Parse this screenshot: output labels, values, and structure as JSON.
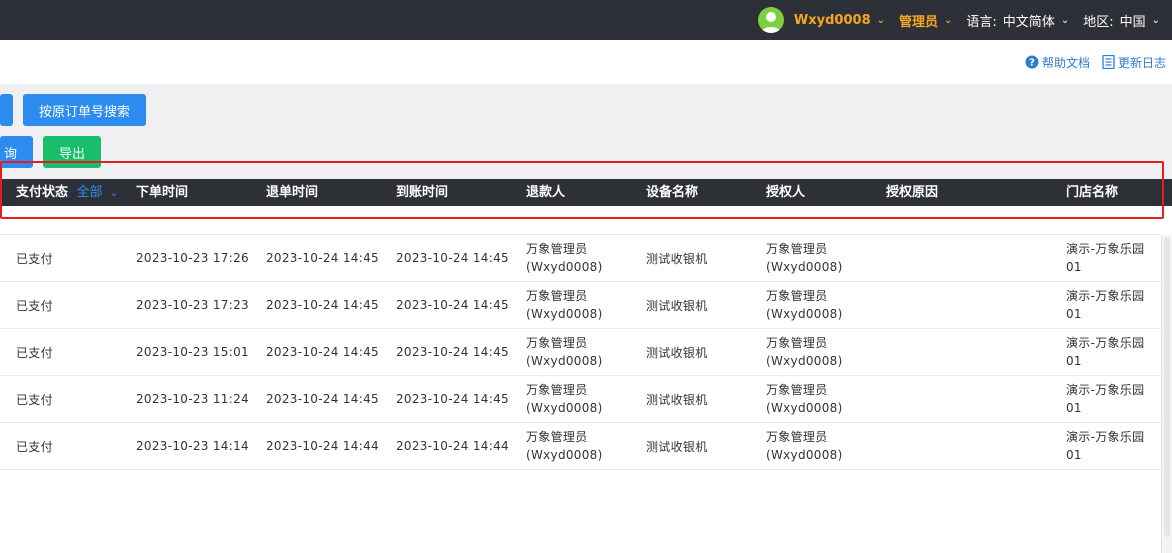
{
  "topbar": {
    "username": "Wxyd0008",
    "role": "管理员",
    "language_label": "语言:",
    "language_value": "中文简体",
    "region_label": "地区:",
    "region_value": "中国"
  },
  "help": {
    "docs": "帮助文档",
    "changelog": "更新日志"
  },
  "toolbar": {
    "search_by_original": "按原订单号搜索",
    "query_partial": "询",
    "export": "导出"
  },
  "table": {
    "headers": {
      "pay_status": "支付状态",
      "pay_status_filter": "全部",
      "order_time": "下单时间",
      "refund_time": "退单时间",
      "arrival_time": "到账时间",
      "refunder": "退款人",
      "device": "设备名称",
      "authorizer": "授权人",
      "auth_reason": "授权原因",
      "store": "门店名称"
    },
    "rows": [
      {
        "status": "已支付",
        "order_time": "2023-10-23 17:26",
        "refund_time": "2023-10-24 14:45",
        "arrival_time": "2023-10-24 14:45",
        "refunder_name": "万象管理员",
        "refunder_id": "(Wxyd0008)",
        "device": "测试收银机",
        "auth_name": "万象管理员",
        "auth_id": "(Wxyd0008)",
        "auth_reason": "",
        "store_line1": "演示-万象乐园",
        "store_line2": "01"
      },
      {
        "status": "已支付",
        "order_time": "2023-10-23 17:23",
        "refund_time": "2023-10-24 14:45",
        "arrival_time": "2023-10-24 14:45",
        "refunder_name": "万象管理员",
        "refunder_id": "(Wxyd0008)",
        "device": "测试收银机",
        "auth_name": "万象管理员",
        "auth_id": "(Wxyd0008)",
        "auth_reason": "",
        "store_line1": "演示-万象乐园",
        "store_line2": "01"
      },
      {
        "status": "已支付",
        "order_time": "2023-10-23 15:01",
        "refund_time": "2023-10-24 14:45",
        "arrival_time": "2023-10-24 14:45",
        "refunder_name": "万象管理员",
        "refunder_id": "(Wxyd0008)",
        "device": "测试收银机",
        "auth_name": "万象管理员",
        "auth_id": "(Wxyd0008)",
        "auth_reason": "",
        "store_line1": "演示-万象乐园",
        "store_line2": "01"
      },
      {
        "status": "已支付",
        "order_time": "2023-10-23 11:24",
        "refund_time": "2023-10-24 14:45",
        "arrival_time": "2023-10-24 14:45",
        "refunder_name": "万象管理员",
        "refunder_id": "(Wxyd0008)",
        "device": "测试收银机",
        "auth_name": "万象管理员",
        "auth_id": "(Wxyd0008)",
        "auth_reason": "",
        "store_line1": "演示-万象乐园",
        "store_line2": "01"
      },
      {
        "status": "已支付",
        "order_time": "2023-10-23 14:14",
        "refund_time": "2023-10-24 14:44",
        "arrival_time": "2023-10-24 14:44",
        "refunder_name": "万象管理员",
        "refunder_id": "(Wxyd0008)",
        "device": "测试收银机",
        "auth_name": "万象管理员",
        "auth_id": "(Wxyd0008)",
        "auth_reason": "",
        "store_line1": "演示-万象乐园",
        "store_line2": "01"
      }
    ]
  },
  "colors": {
    "topbar_bg": "#2e3038",
    "accent_orange": "#f5a623",
    "primary_blue": "#2d8cf0",
    "success_green": "#19be6b",
    "highlight_red": "#e02020"
  },
  "icons": [
    "user-avatar-icon",
    "chevron-down-icon",
    "help-circle-icon",
    "document-icon"
  ]
}
